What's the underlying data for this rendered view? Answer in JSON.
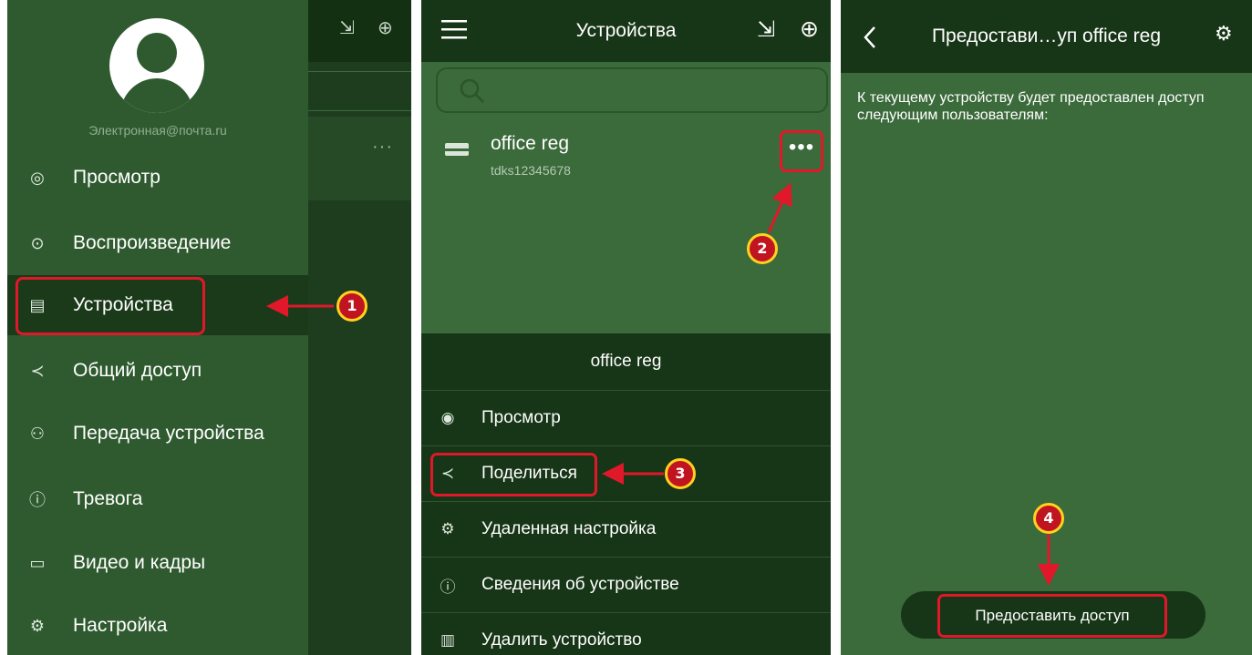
{
  "panel1": {
    "email": "Электронная@почта.ru",
    "menu": [
      {
        "label": "Просмотр",
        "icon": "camera-icon"
      },
      {
        "label": "Воспроизведение",
        "icon": "play-icon"
      },
      {
        "label": "Устройства",
        "icon": "devices-icon"
      },
      {
        "label": "Общий доступ",
        "icon": "share-icon"
      },
      {
        "label": "Передача устройства",
        "icon": "transfer-icon"
      },
      {
        "label": "Тревога",
        "icon": "alarm-icon"
      },
      {
        "label": "Видео и кадры",
        "icon": "folder-icon"
      },
      {
        "label": "Настройка",
        "icon": "settings-icon"
      }
    ],
    "marker": "1"
  },
  "panel2": {
    "title": "Устройства",
    "device": {
      "name": "office reg",
      "id": "tdks12345678"
    },
    "more": "•••",
    "marker2": "2",
    "sheet_title": "office reg",
    "sheet_items": [
      {
        "label": "Просмотр",
        "icon": "eye-icon"
      },
      {
        "label": "Поделиться",
        "icon": "share-icon"
      },
      {
        "label": "Удаленная настройка",
        "icon": "settings-icon"
      },
      {
        "label": "Сведения об устройстве",
        "icon": "info-icon"
      },
      {
        "label": "Удалить устройство",
        "icon": "trash-icon"
      }
    ],
    "marker3": "3"
  },
  "panel3": {
    "title": "Предостави…уп office reg",
    "text": "К текущему устройству будет предоставлен доступ следующим пользователям:",
    "grant_button": "Предоставить доступ",
    "marker": "4"
  },
  "colors": {
    "accent_red": "#e0182a",
    "header": "#173517",
    "body": "#3b6a3b",
    "marker_ring": "#ffd21f"
  }
}
